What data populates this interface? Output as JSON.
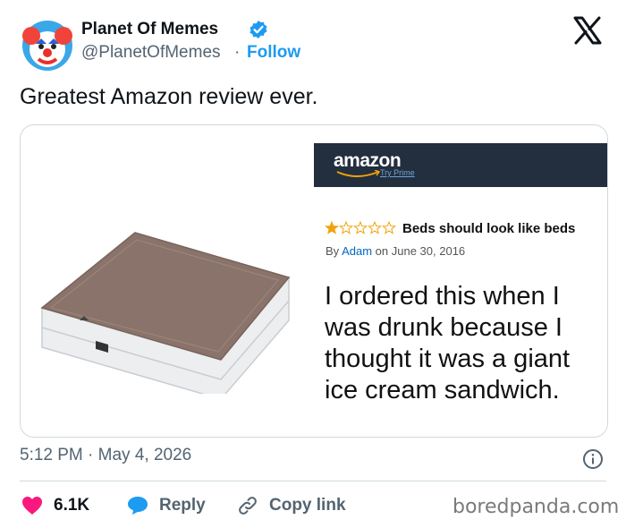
{
  "header": {
    "display_name": "Planet Of Memes",
    "handle": "@PlanetOfMemes",
    "separator": "·",
    "follow_label": "Follow"
  },
  "tweet": {
    "text": "Greatest Amazon review ever."
  },
  "media": {
    "amazon_logo": "amazon",
    "try_prime": "Try Prime",
    "rating_stars": 1,
    "rating_max": 5,
    "review_title": "Beds should look like beds",
    "by_prefix": "By",
    "author": "Adam",
    "date_text": "on June 30, 2016",
    "review_body": "I ordered this when I was drunk because I thought it was a giant ice cream sandwich."
  },
  "timestamp": "5:12 PM · May 4, 2026",
  "actions": {
    "likes": "6.1K",
    "reply_label": "Reply",
    "copy_label": "Copy link"
  },
  "watermark": "boredpanda.com",
  "colors": {
    "link_blue": "#1d9bf0",
    "heart": "#f91880",
    "amazon_bar": "#232f3e",
    "star": "#f0a30a",
    "text_secondary": "#536471"
  }
}
